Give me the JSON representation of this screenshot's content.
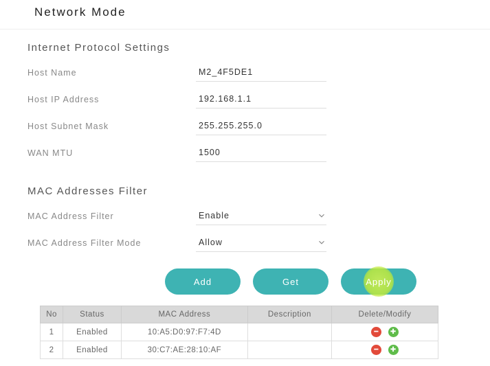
{
  "page_title": "Network Mode",
  "ip_section": {
    "title": "Internet Protocol Settings",
    "host_name_label": "Host Name",
    "host_name_value": "M2_4F5DE1",
    "host_ip_label": "Host IP Address",
    "host_ip_value": "192.168.1.1",
    "subnet_label": "Host Subnet Mask",
    "subnet_value": "255.255.255.0",
    "mtu_label": "WAN MTU",
    "mtu_value": "1500"
  },
  "mac_section": {
    "title": "MAC Addresses Filter",
    "filter_label": "MAC Address Filter",
    "filter_value": "Enable",
    "mode_label": "MAC Address Filter Mode",
    "mode_value": "Allow"
  },
  "buttons": {
    "add": "Add",
    "get": "Get",
    "apply": "Apply"
  },
  "table": {
    "headers": {
      "no": "No",
      "status": "Status",
      "mac": "MAC Address",
      "desc": "Description",
      "dm": "Delete/Modify"
    },
    "rows": [
      {
        "no": "1",
        "status": "Enabled",
        "mac": "10:A5:D0:97:F7:4D",
        "desc": ""
      },
      {
        "no": "2",
        "status": "Enabled",
        "mac": "30:C7:AE:28:10:AF",
        "desc": ""
      }
    ]
  }
}
